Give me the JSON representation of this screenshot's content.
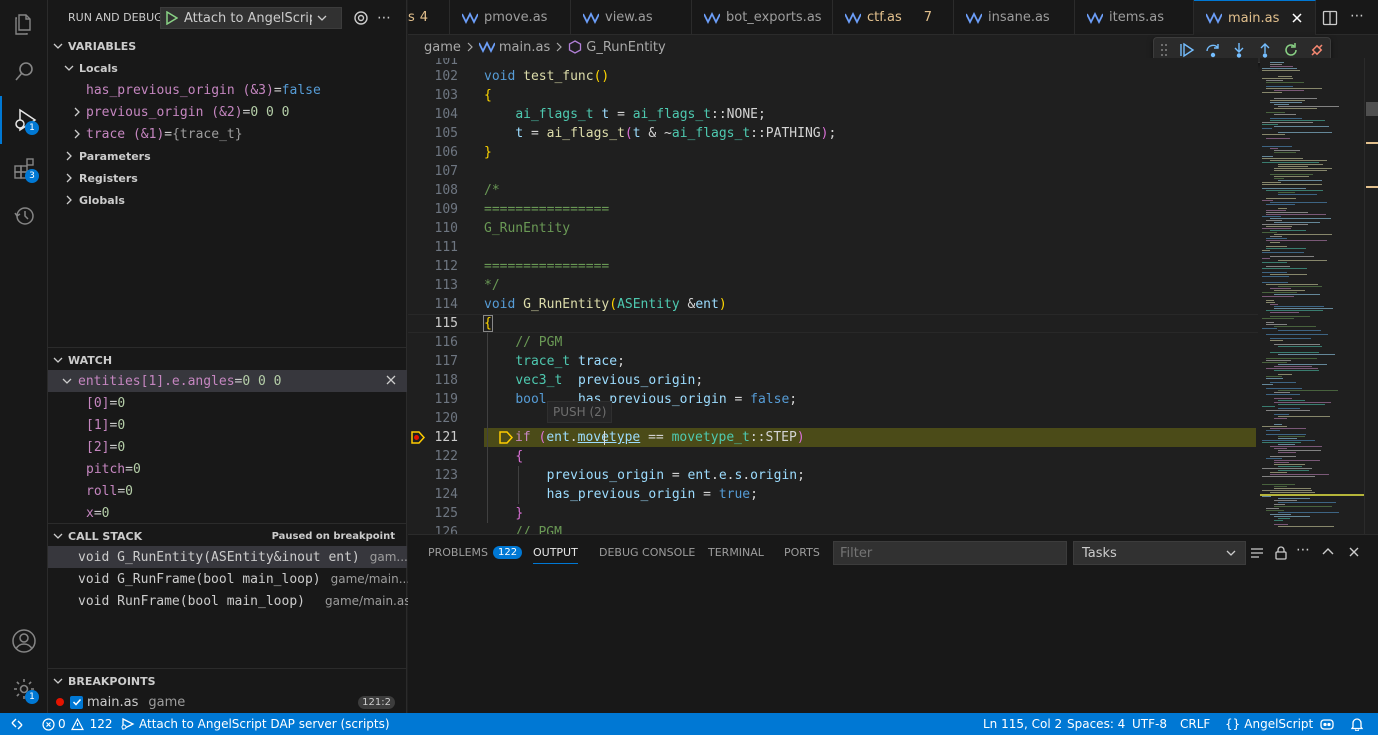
{
  "activity_bar": {
    "run_debug_badge": "1",
    "extensions_badge": "3",
    "manage_badge": "1"
  },
  "sidebar": {
    "title": "RUN AND DEBUG",
    "launch_config": "Attach to AngelScript D",
    "variables": {
      "header": "VARIABLES",
      "locals_label": "Locals",
      "items": [
        {
          "name": "has_previous_origin (&3)",
          "eq": " = ",
          "value": "false"
        },
        {
          "name": "previous_origin (&2)",
          "eq": " = ",
          "value": "0 0 0"
        },
        {
          "name": "trace (&1)",
          "eq": " = ",
          "value": "{trace_t}"
        }
      ],
      "groups": [
        "Parameters",
        "Registers",
        "Globals"
      ]
    },
    "watch": {
      "header": "WATCH",
      "expression": "entities[1].e.angles",
      "expression_value": "0 0 0",
      "children": [
        {
          "name": "[0]",
          "value": "0"
        },
        {
          "name": "[1]",
          "value": "0"
        },
        {
          "name": "[2]",
          "value": "0"
        },
        {
          "name": "pitch",
          "value": "0"
        },
        {
          "name": "roll",
          "value": "0"
        },
        {
          "name": "x",
          "value": "0"
        }
      ]
    },
    "call_stack": {
      "header": "CALL STACK",
      "state": "Paused on breakpoint",
      "frames": [
        {
          "func": "void G_RunEntity(ASEntity&inout ent)",
          "file": "gam..."
        },
        {
          "func": "void G_RunFrame(bool main_loop)",
          "file": "game/main..."
        },
        {
          "func": "void RunFrame(bool main_loop)",
          "file": "game/main.as"
        }
      ]
    },
    "breakpoints": {
      "header": "BREAKPOINTS",
      "items": [
        {
          "file": "main.as",
          "folder": "game",
          "location": "121:2"
        }
      ]
    }
  },
  "tabs": [
    {
      "label": "s",
      "badge": "4"
    },
    {
      "label": "pmove.as",
      "badge": ""
    },
    {
      "label": "view.as",
      "badge": ""
    },
    {
      "label": "bot_exports.as",
      "badge": ""
    },
    {
      "label": "ctf.as",
      "badge": "7"
    },
    {
      "label": "insane.as",
      "badge": ""
    },
    {
      "label": "items.as",
      "badge": ""
    },
    {
      "label": "main.as",
      "badge": ""
    }
  ],
  "breadcrumb": {
    "folder": "game",
    "file": "main.as",
    "symbol": "G_RunEntity"
  },
  "editor": {
    "hover_hint": "PUSH (2)",
    "top_partial_line": "101",
    "bottom_partial_line": "126",
    "bottom_partial_code": "// PGM"
  },
  "panel": {
    "tabs": [
      "PROBLEMS",
      "OUTPUT",
      "DEBUG CONSOLE",
      "TERMINAL",
      "PORTS"
    ],
    "problems_count": "122",
    "filter_placeholder": "Filter",
    "output_channel": "Tasks"
  },
  "status_bar": {
    "errors": "0",
    "warnings": "122",
    "debug_session": "Attach to AngelScript DAP server (scripts)",
    "position": "Ln 115, Col 2",
    "spaces": "Spaces: 4",
    "encoding": "UTF-8",
    "eol": "CRLF",
    "language": "AngelScript"
  },
  "colors": {
    "accent": "#0078d4",
    "current_line_highlight": "#4b4b18",
    "breakpoint": "#e51400",
    "modified_tab": "#e2c08d"
  }
}
